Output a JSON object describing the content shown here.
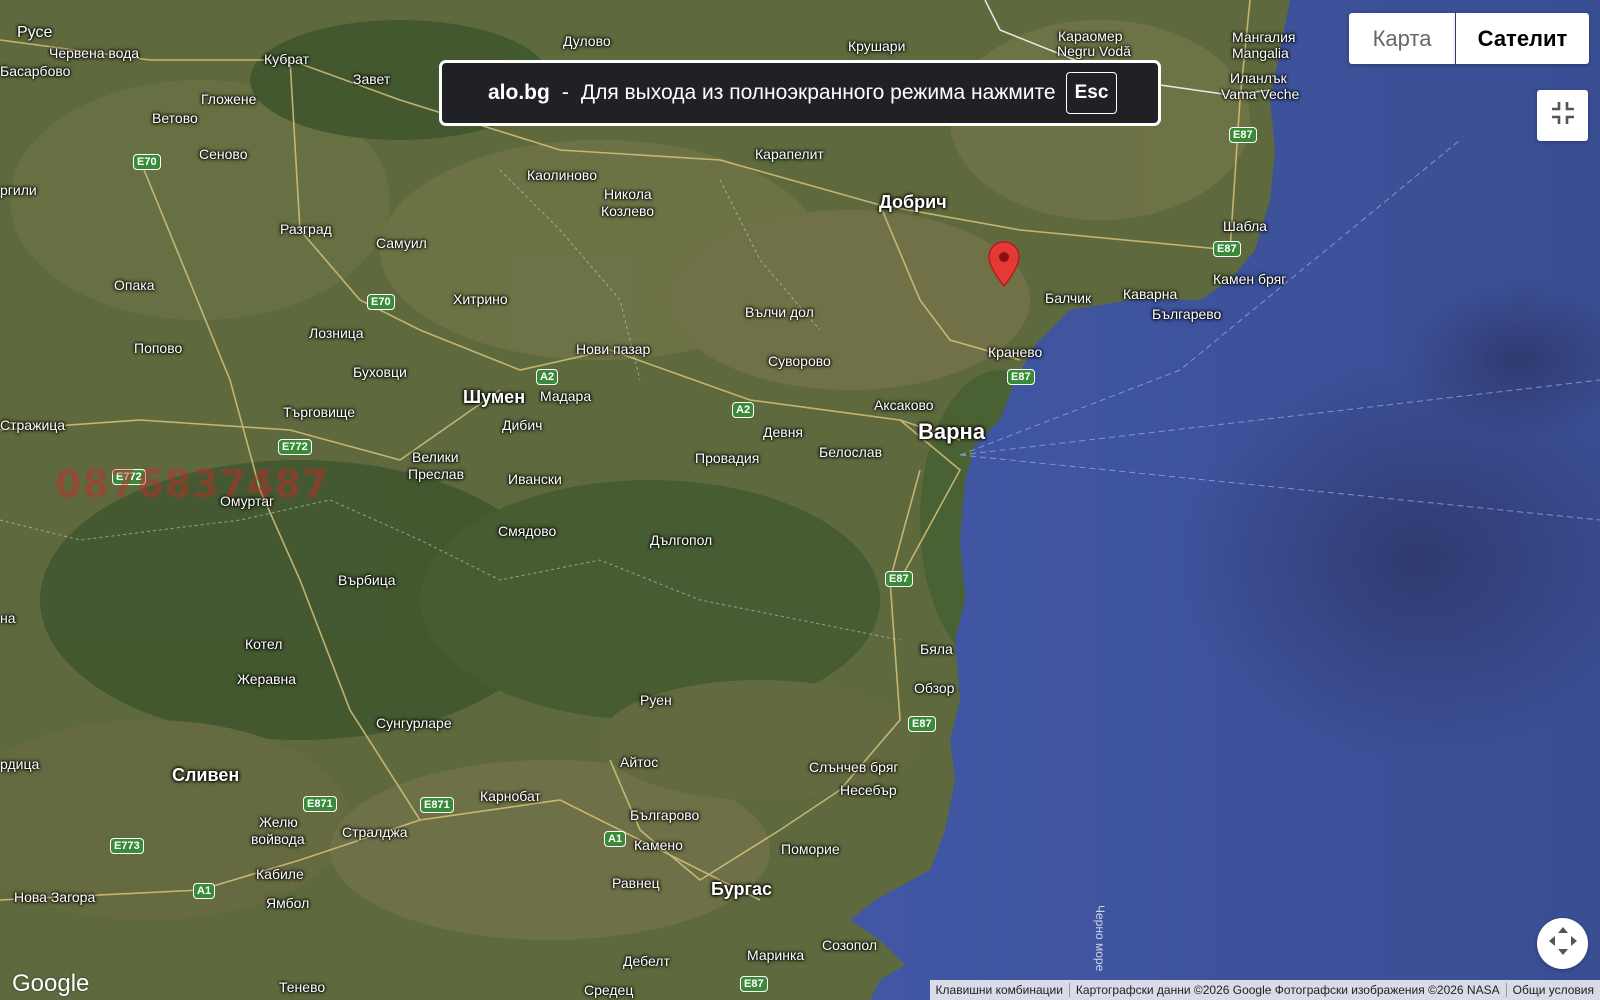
{
  "banner": {
    "site": "alo.bg",
    "separator": "-",
    "message": "Для выхода из полноэкранного режима нажмите",
    "key": "Esc"
  },
  "controls": {
    "map_label": "Карта",
    "satellite_label": "Сателит",
    "exit_fullscreen_icon": "exit-fullscreen-icon",
    "camera_icon": "camera-control-icon"
  },
  "watermark_phone": "0876837487",
  "sea_label": "Черно море",
  "logo": "Google",
  "footer": {
    "shortcuts": "Клавишни комбинации",
    "attribution": "Картографски данни ©2026 Google Фотографски изображения ©2026 NASA",
    "terms": "Общи условия"
  },
  "places": [
    {
      "name": "Русе"
    },
    {
      "name": "Червена вода"
    },
    {
      "name": "Басарбово"
    },
    {
      "name": "Кубрат"
    },
    {
      "name": "Завет"
    },
    {
      "name": "Гложене"
    },
    {
      "name": "Ветово"
    },
    {
      "name": "Сеново"
    },
    {
      "name": "Дулово"
    },
    {
      "name": "Крушари"
    },
    {
      "name": "Караомер"
    },
    {
      "name": "Negru Vodă"
    },
    {
      "name": "Мангалия"
    },
    {
      "name": "Mangalia"
    },
    {
      "name": "Иланлък"
    },
    {
      "name": "Vama Veche"
    },
    {
      "name": "Каолиново"
    },
    {
      "name": "Никола"
    },
    {
      "name": "Козлево"
    },
    {
      "name": "Карапелит"
    },
    {
      "name": "Добрич"
    },
    {
      "name": "Шабла"
    },
    {
      "name": "Камен бряг"
    },
    {
      "name": "Балчик"
    },
    {
      "name": "Каварна"
    },
    {
      "name": "Българево"
    },
    {
      "name": "Разград"
    },
    {
      "name": "Самуил"
    },
    {
      "name": "Хитрино"
    },
    {
      "name": "Вълчи дол"
    },
    {
      "name": "Опака"
    },
    {
      "name": "Лозница"
    },
    {
      "name": "Попово"
    },
    {
      "name": "Нови пазар"
    },
    {
      "name": "Суворово"
    },
    {
      "name": "Кранево"
    },
    {
      "name": "Буховци"
    },
    {
      "name": "Шумен"
    },
    {
      "name": "Мадара"
    },
    {
      "name": "Търговище"
    },
    {
      "name": "Дибич"
    },
    {
      "name": "Аксаково"
    },
    {
      "name": "Девня"
    },
    {
      "name": "Варна"
    },
    {
      "name": "Белослав"
    },
    {
      "name": "Стражица"
    },
    {
      "name": "Провадия"
    },
    {
      "name": "Велики"
    },
    {
      "name": "Преслав"
    },
    {
      "name": "Ивански"
    },
    {
      "name": "Омуртаг"
    },
    {
      "name": "Смядово"
    },
    {
      "name": "Дългопол"
    },
    {
      "name": "Върбица"
    },
    {
      "name": "Котел"
    },
    {
      "name": "Бяла"
    },
    {
      "name": "Жеравна"
    },
    {
      "name": "Обзор"
    },
    {
      "name": "Руен"
    },
    {
      "name": "Сунгурларе"
    },
    {
      "name": "Айтос"
    },
    {
      "name": "Слънчев бряг"
    },
    {
      "name": "Сливен"
    },
    {
      "name": "Несебър"
    },
    {
      "name": "Карнобат"
    },
    {
      "name": "Желю"
    },
    {
      "name": "войвода"
    },
    {
      "name": "Стралджа"
    },
    {
      "name": "Българово"
    },
    {
      "name": "Камено"
    },
    {
      "name": "Поморие"
    },
    {
      "name": "Кабиле"
    },
    {
      "name": "Нова Загора"
    },
    {
      "name": "Ямбол"
    },
    {
      "name": "Равнец"
    },
    {
      "name": "Бургас"
    },
    {
      "name": "Созопол"
    },
    {
      "name": "Маринка"
    },
    {
      "name": "Дебелт"
    },
    {
      "name": "Тенево"
    },
    {
      "name": "Средец"
    },
    {
      "name": "ргили"
    },
    {
      "name": "на"
    },
    {
      "name": "рдица"
    }
  ],
  "roads": [
    "E70",
    "E70",
    "A2",
    "A2",
    "E87",
    "E87",
    "E87",
    "E87",
    "E87",
    "E772",
    "E772",
    "E871",
    "E871",
    "E773",
    "A1",
    "A1",
    "E87"
  ]
}
